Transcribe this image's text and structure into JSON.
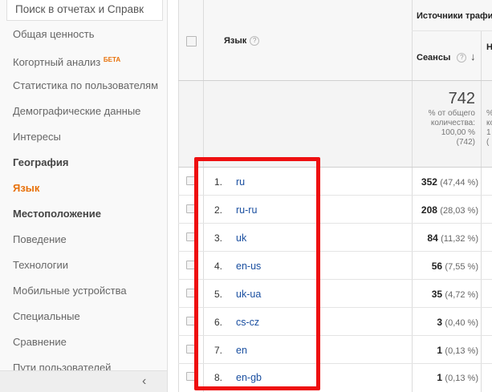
{
  "sidebar": {
    "search_placeholder": "Поиск в отчетах и Справк",
    "items": [
      {
        "label": "Общая ценность",
        "style": "normal"
      },
      {
        "label": "Когортный анализ",
        "badge": "БЕТА",
        "style": "normal"
      },
      {
        "label": "Статистика по пользователям",
        "style": "normal"
      },
      {
        "label": "Демографические данные",
        "style": "normal"
      },
      {
        "label": "Интересы",
        "style": "normal"
      },
      {
        "label": "География",
        "style": "bold"
      },
      {
        "label": "Язык",
        "style": "active"
      },
      {
        "label": "Местоположение",
        "style": "bold"
      },
      {
        "label": "Поведение",
        "style": "normal"
      },
      {
        "label": "Технологии",
        "style": "normal"
      },
      {
        "label": "Мобильные устройства",
        "style": "normal"
      },
      {
        "label": "Специальные",
        "style": "normal"
      },
      {
        "label": "Сравнение",
        "style": "normal"
      },
      {
        "label": "Пути пользователей",
        "style": "normal"
      }
    ],
    "collapse_icon": "chevron-left-icon",
    "collapse_glyph": "‹"
  },
  "table": {
    "col_language": "Язык",
    "group_header": "Источники трафи",
    "second_group_header": "Н",
    "col_sessions": "Сеансы",
    "help_glyph": "?",
    "sort_glyph": "↓",
    "totals": {
      "sessions": "742",
      "line1": "% от общего",
      "line2": "количества:",
      "line3": "100,00 %",
      "line4": "(742)",
      "side1": "%",
      "side2": "ко",
      "side3": "1",
      "side4": "("
    },
    "rows": [
      {
        "num": "1.",
        "lang": "ru",
        "sessions": "352",
        "pct": "(47,44 %)"
      },
      {
        "num": "2.",
        "lang": "ru-ru",
        "sessions": "208",
        "pct": "(28,03 %)"
      },
      {
        "num": "3.",
        "lang": "uk",
        "sessions": "84",
        "pct": "(11,32 %)"
      },
      {
        "num": "4.",
        "lang": "en-us",
        "sessions": "56",
        "pct": "(7,55 %)"
      },
      {
        "num": "5.",
        "lang": "uk-ua",
        "sessions": "35",
        "pct": "(4,72 %)"
      },
      {
        "num": "6.",
        "lang": "cs-cz",
        "sessions": "3",
        "pct": "(0,40 %)"
      },
      {
        "num": "7.",
        "lang": "en",
        "sessions": "1",
        "pct": "(0,13 %)"
      },
      {
        "num": "8.",
        "lang": "en-gb",
        "sessions": "1",
        "pct": "(0,13 %)"
      }
    ]
  },
  "colors": {
    "accent": "#e8710a",
    "link": "#1a4fa0",
    "highlight": "#ee0f10"
  }
}
